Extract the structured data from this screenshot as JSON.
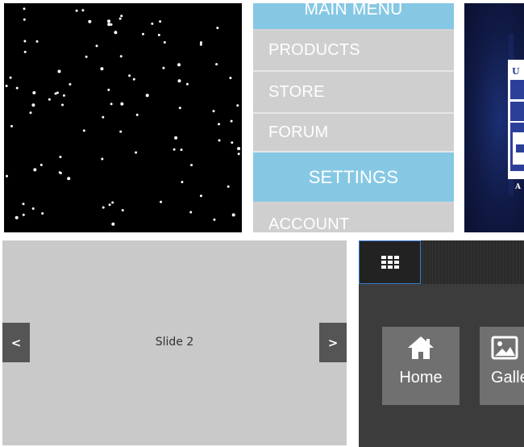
{
  "menu": {
    "title": "MAIN MENU",
    "items": [
      {
        "label": "PRODUCTS"
      },
      {
        "label": "STORE"
      },
      {
        "label": "FORUM"
      },
      {
        "label": "SETTINGS"
      },
      {
        "label": "ACCOUNT"
      }
    ],
    "active_index": 3,
    "colors": {
      "active": "#86c8e4",
      "item": "#cfcfcf",
      "text": "#ffffff"
    }
  },
  "slider": {
    "slide_text": "Slide 2",
    "prev_label": "<",
    "next_label": ">"
  },
  "metro": {
    "grid_icon": "grid-icon",
    "tiles": [
      {
        "label": "Home",
        "icon": "home-icon"
      },
      {
        "label": "Gallery",
        "icon": "image-icon"
      }
    ],
    "accent": "#3a7bd5"
  },
  "logo_banner": {
    "visible_letters": [
      "U",
      "A"
    ],
    "colors": {
      "background": "#101a45"
    }
  }
}
